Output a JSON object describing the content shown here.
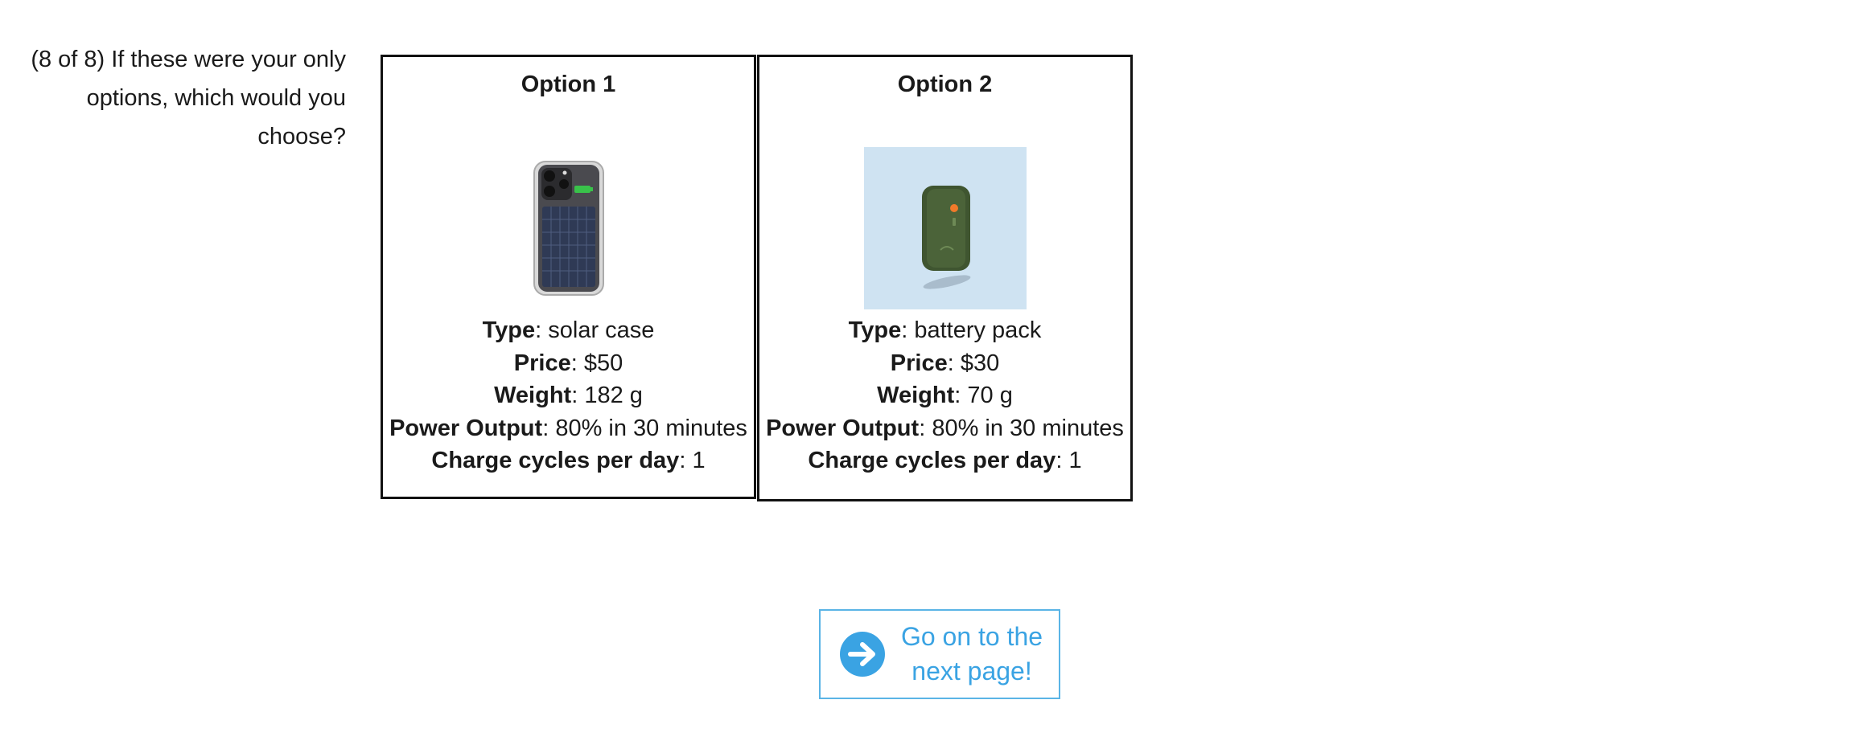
{
  "question": {
    "text": "(8 of 8) If these were your only options, which would you choose?"
  },
  "options": [
    {
      "title": "Option 1",
      "image_icon": "solar-case-phone-image",
      "attributes": [
        {
          "label": "Type",
          "value": "solar case"
        },
        {
          "label": "Price",
          "value": "$50"
        },
        {
          "label": "Weight",
          "value": "182 g"
        },
        {
          "label": "Power Output",
          "value": "80% in 30 minutes"
        },
        {
          "label": "Charge cycles per day",
          "value": "1"
        }
      ]
    },
    {
      "title": "Option 2",
      "image_icon": "battery-pack-image",
      "attributes": [
        {
          "label": "Type",
          "value": "battery pack"
        },
        {
          "label": "Price",
          "value": "$30"
        },
        {
          "label": "Weight",
          "value": "70 g"
        },
        {
          "label": "Power Output",
          "value": "80% in 30 minutes"
        },
        {
          "label": "Charge cycles per day",
          "value": "1"
        }
      ]
    }
  ],
  "next_button": {
    "line1": "Go on to the",
    "line2": "next page!",
    "icon": "arrow-right-circle-icon"
  },
  "colors": {
    "accent": "#3aa3e3",
    "border": "#111111",
    "image_bg": "#cfe3f2",
    "pack_green": "#3f5530"
  }
}
